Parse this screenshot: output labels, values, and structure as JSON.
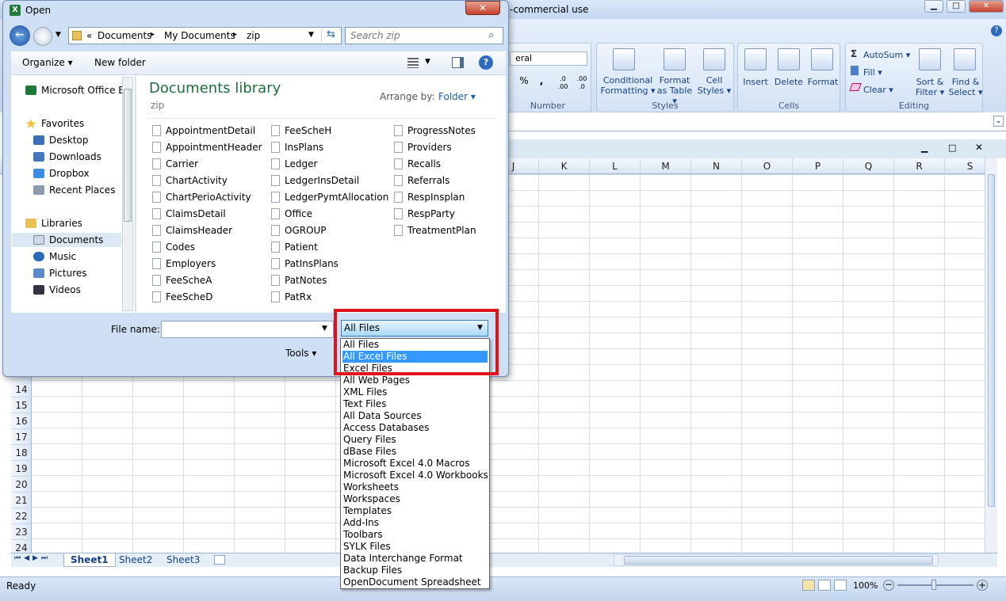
{
  "excel": {
    "title_fragment": "-commercial use",
    "number_format": "eral",
    "ribbon_groups": {
      "number": "Number",
      "styles": "Styles",
      "cells": "Cells",
      "editing": "Editing"
    },
    "buttons": {
      "conditional_formatting": "Conditional\nFormatting ▾",
      "format_as_table": "Format\nas Table ▾",
      "cell_styles": "Cell\nStyles ▾",
      "insert": "Insert",
      "delete": "Delete",
      "format": "Format",
      "autosum": "AutoSum ▾",
      "fill": "Fill ▾",
      "clear": "Clear ▾",
      "sort_filter": "Sort &\nFilter ▾",
      "find_select": "Find &\nSelect ▾",
      "percent": "%",
      "comma": ",",
      "inc_dec": ".0 .00",
      "dec_dec": ".00 .0"
    },
    "columns": [
      "J",
      "K",
      "L",
      "M",
      "N",
      "O",
      "P",
      "Q",
      "R",
      "S"
    ],
    "rows": [
      "14",
      "15",
      "16",
      "17",
      "18",
      "19",
      "20",
      "21",
      "22",
      "23",
      "24"
    ],
    "sheets": [
      "Sheet1",
      "Sheet2",
      "Sheet3"
    ],
    "status": "Ready",
    "zoom": "100%"
  },
  "dialog": {
    "title": "Open",
    "breadcrumb": [
      "«",
      "Documents",
      "▸",
      "My Documents",
      "▸",
      "zip"
    ],
    "search_placeholder": "Search zip",
    "organize": "Organize ▾",
    "new_folder": "New folder",
    "library_title": "Documents library",
    "library_sub": "zip",
    "arrange_label": "Arrange by:",
    "arrange_value": "Folder ▾",
    "nav": {
      "office": "Microsoft Office Ex",
      "favorites": "Favorites",
      "desktop": "Desktop",
      "downloads": "Downloads",
      "dropbox": "Dropbox",
      "recent": "Recent Places",
      "libraries": "Libraries",
      "documents": "Documents",
      "music": "Music",
      "pictures": "Pictures",
      "videos": "Videos"
    },
    "files_col1": [
      "AppointmentDetail",
      "AppointmentHeader",
      "Carrier",
      "ChartActivity",
      "ChartPerioActivity",
      "ClaimsDetail",
      "ClaimsHeader",
      "Codes",
      "Employers",
      "FeeScheA",
      "FeeScheD"
    ],
    "files_col2": [
      "FeeScheH",
      "InsPlans",
      "Ledger",
      "LedgerInsDetail",
      "LedgerPymtAllocation",
      "Office",
      "OGROUP",
      "Patient",
      "PatInsPlans",
      "PatNotes",
      "PatRx"
    ],
    "files_col3": [
      "ProgressNotes",
      "Providers",
      "Recalls",
      "Referrals",
      "RespInsplan",
      "RespParty",
      "TreatmentPlan"
    ],
    "file_name_label": "File name:",
    "file_name_value": "",
    "tools": "Tools ▾",
    "file_type_selected": "All Files",
    "file_type_options": [
      "All Files",
      "All Excel Files",
      "Excel Files",
      "All Web Pages",
      "XML Files",
      "Text Files",
      "All Data Sources",
      "Access Databases",
      "Query Files",
      "dBase Files",
      "Microsoft Excel 4.0 Macros",
      "Microsoft Excel 4.0 Workbooks",
      "Worksheets",
      "Workspaces",
      "Templates",
      "Add-Ins",
      "Toolbars",
      "SYLK Files",
      "Data Interchange Format",
      "Backup Files",
      "OpenDocument Spreadsheet"
    ],
    "highlighted_option": "All Excel Files"
  },
  "colors": {
    "highlight_box": "#e0131c",
    "selection": "#3399ff",
    "library_title": "#1e6f3c"
  }
}
